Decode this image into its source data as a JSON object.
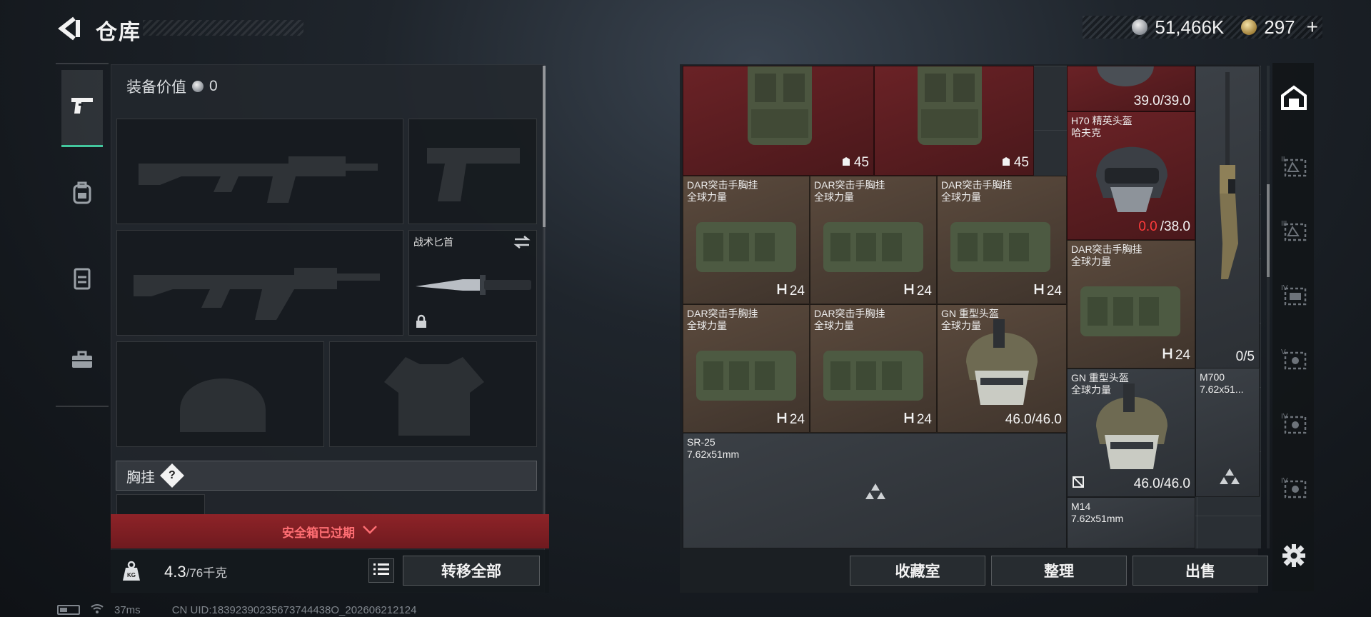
{
  "header": {
    "title": "仓库",
    "currency_silver": "51,466K",
    "currency_gold": "297",
    "plus": "+"
  },
  "loadout": {
    "value_label": "装备价值",
    "value": "0",
    "knife_label": "战术匕首",
    "rig_label": "胸挂",
    "rig_help": "?",
    "expired_text": "安全箱已过期",
    "weight_current": "4.3",
    "weight_max": "/76千克",
    "transfer_all": "转移全部"
  },
  "storage": {
    "items": [
      {
        "id": "armor1",
        "name": "",
        "meta": "45"
      },
      {
        "id": "armor2",
        "name": "",
        "meta": "45"
      },
      {
        "id": "helmet-top",
        "name": "",
        "meta": "39.0/39.0"
      },
      {
        "id": "h70",
        "name": "H70 精英头盔\n哈夫克",
        "meta_red": "0.0",
        "meta": "/38.0"
      },
      {
        "id": "dar1",
        "name": "DAR突击手胸挂\n全球力量",
        "meta": "24"
      },
      {
        "id": "dar2",
        "name": "DAR突击手胸挂\n全球力量",
        "meta": "24"
      },
      {
        "id": "dar3",
        "name": "DAR突击手胸挂\n全球力量",
        "meta": "24"
      },
      {
        "id": "dar4",
        "name": "DAR突击手胸挂\n全球力量",
        "meta": "24"
      },
      {
        "id": "dar5",
        "name": "DAR突击手胸挂\n全球力量",
        "meta": "24"
      },
      {
        "id": "dar6",
        "name": "DAR突击手胸挂\n全球力量",
        "meta": "24"
      },
      {
        "id": "gn1",
        "name": "GN 重型头盔\n全球力量",
        "meta": "46.0/46.0"
      },
      {
        "id": "gn2",
        "name": "GN 重型头盔\n全球力量",
        "meta": "46.0/46.0"
      },
      {
        "id": "m700",
        "name": "M700\n7.62x51...",
        "meta": "0/5"
      },
      {
        "id": "sr25",
        "name": "SR-25\n7.62x51mm",
        "meta": ""
      },
      {
        "id": "m14",
        "name": "M14\n7.62x51mm",
        "meta": ""
      }
    ],
    "buttons": {
      "collection": "收藏室",
      "sort": "整理",
      "sell": "出售"
    }
  },
  "status": {
    "ping": "37ms",
    "uid": "CN UID:18392390235673744438O_202606212124"
  },
  "colors": {
    "accent": "#43c79e",
    "alert_red": "#8e2328",
    "rare_red": "#6a2226",
    "rare_brown": "#5b4a3d"
  }
}
